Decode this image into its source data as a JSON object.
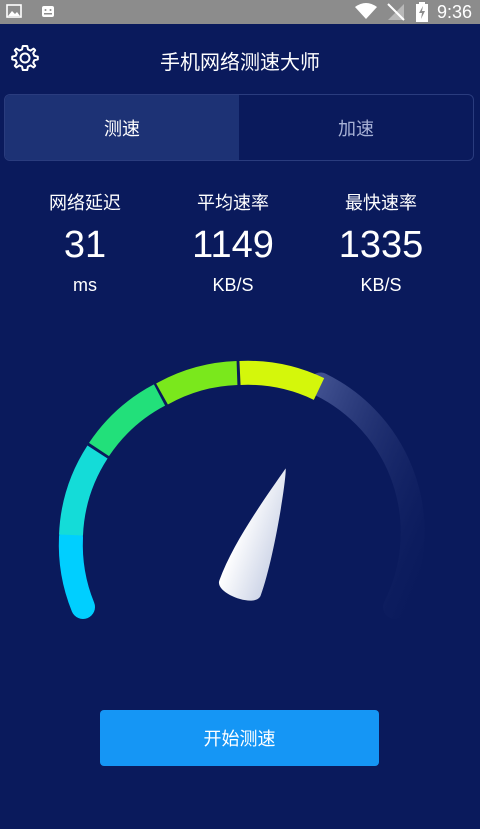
{
  "status_bar": {
    "time": "9:36",
    "icons": [
      "image-icon",
      "android-icon",
      "wifi-icon",
      "signal-off-icon",
      "battery-charging-icon"
    ]
  },
  "header": {
    "title": "手机网络测速大师",
    "settings_icon": "gear-icon"
  },
  "tabs": [
    {
      "label": "测速",
      "active": true
    },
    {
      "label": "加速",
      "active": false
    }
  ],
  "stats": [
    {
      "label": "网络延迟",
      "value": "31",
      "unit": "ms"
    },
    {
      "label": "平均速率",
      "value": "1149",
      "unit": "KB/S"
    },
    {
      "label": "最快速率",
      "value": "1335",
      "unit": "KB/S"
    }
  ],
  "start_button": {
    "label": "开始测速"
  },
  "colors": {
    "background": "#0a1a5c",
    "accent": "#1596f5",
    "gauge_start": "#00d2ff",
    "gauge_end": "#d4f70b"
  }
}
